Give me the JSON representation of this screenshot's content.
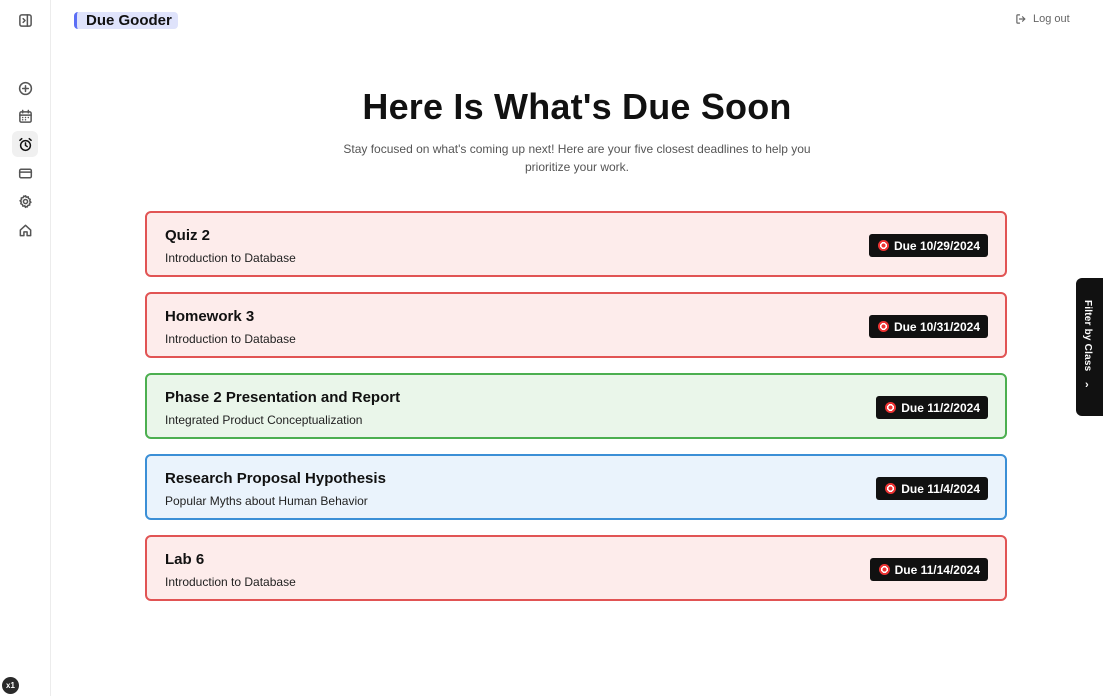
{
  "app": {
    "brand": "Due Gooder",
    "logout_label": "Log out",
    "zoom_badge": "x1"
  },
  "sidebar": {
    "items": [
      {
        "name": "toggle-sidebar",
        "icon": "panel-toggle-icon"
      },
      {
        "name": "add",
        "icon": "plus-circle-icon"
      },
      {
        "name": "calendar",
        "icon": "calendar-icon"
      },
      {
        "name": "due-soon",
        "icon": "alarm-clock-icon",
        "active": true
      },
      {
        "name": "cards",
        "icon": "credit-card-icon"
      },
      {
        "name": "settings",
        "icon": "gear-icon"
      },
      {
        "name": "home",
        "icon": "home-icon"
      }
    ]
  },
  "header": {
    "title": "Here Is What's Due Soon",
    "subtitle": "Stay focused on what's coming up next! Here are your five closest deadlines to help you prioritize your work."
  },
  "deadlines": [
    {
      "title": "Quiz 2",
      "course": "Introduction to Database",
      "due": "Due 10/29/2024",
      "border": "#e15454",
      "bg": "#fdeceb"
    },
    {
      "title": "Homework 3",
      "course": "Introduction to Database",
      "due": "Due 10/31/2024",
      "border": "#e15454",
      "bg": "#fdeceb"
    },
    {
      "title": "Phase 2 Presentation and Report",
      "course": "Integrated Product Conceptualization",
      "due": "Due 11/2/2024",
      "border": "#4caf50",
      "bg": "#eaf6ea"
    },
    {
      "title": "Research Proposal Hypothesis",
      "course": "Popular Myths about Human Behavior",
      "due": "Due 11/4/2024",
      "border": "#3b8fd6",
      "bg": "#eaf3fc"
    },
    {
      "title": "Lab 6",
      "course": "Introduction to Database",
      "due": "Due 11/14/2024",
      "border": "#e15454",
      "bg": "#fdeceb"
    }
  ],
  "filter_tab": {
    "label": "Filter by Class",
    "chevron": "›"
  }
}
